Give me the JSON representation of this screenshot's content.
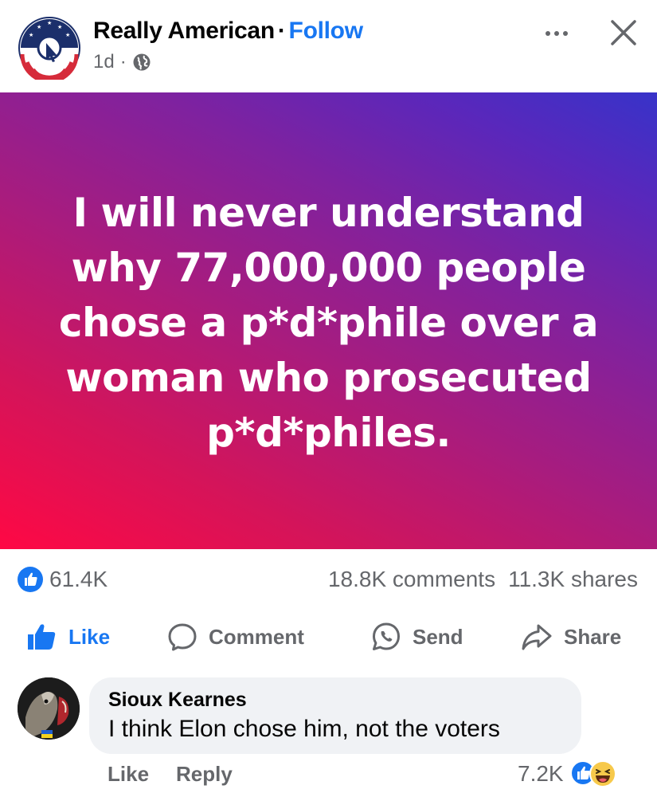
{
  "header": {
    "page_name": "Really American",
    "separator": "·",
    "follow_label": "Follow",
    "time": "1d",
    "time_separator": "·",
    "privacy_icon": "globe-icon",
    "more_icon": "more-icon",
    "close_icon": "close-icon"
  },
  "post": {
    "text": "I will never understand why 77,000,000 people chose a p*d*phile over a woman who prosecuted p*d*philes.",
    "gradient": [
      "#ff0844",
      "#a81c7e",
      "#3733c9"
    ]
  },
  "stats": {
    "likes": "61.4K",
    "comments": "18.8K comments",
    "shares": "11.3K shares"
  },
  "actions": {
    "like": "Like",
    "comment": "Comment",
    "send": "Send",
    "share": "Share"
  },
  "comment": {
    "author": "Sioux Kearnes",
    "text": "I think Elon chose him, not the voters",
    "like_label": "Like",
    "reply_label": "Reply",
    "reaction_count": "7.2K",
    "reactions": [
      "like-icon",
      "haha-icon"
    ]
  },
  "colors": {
    "accent": "#1877f2",
    "secondary_text": "#65676b",
    "bubble": "#f0f2f5"
  }
}
